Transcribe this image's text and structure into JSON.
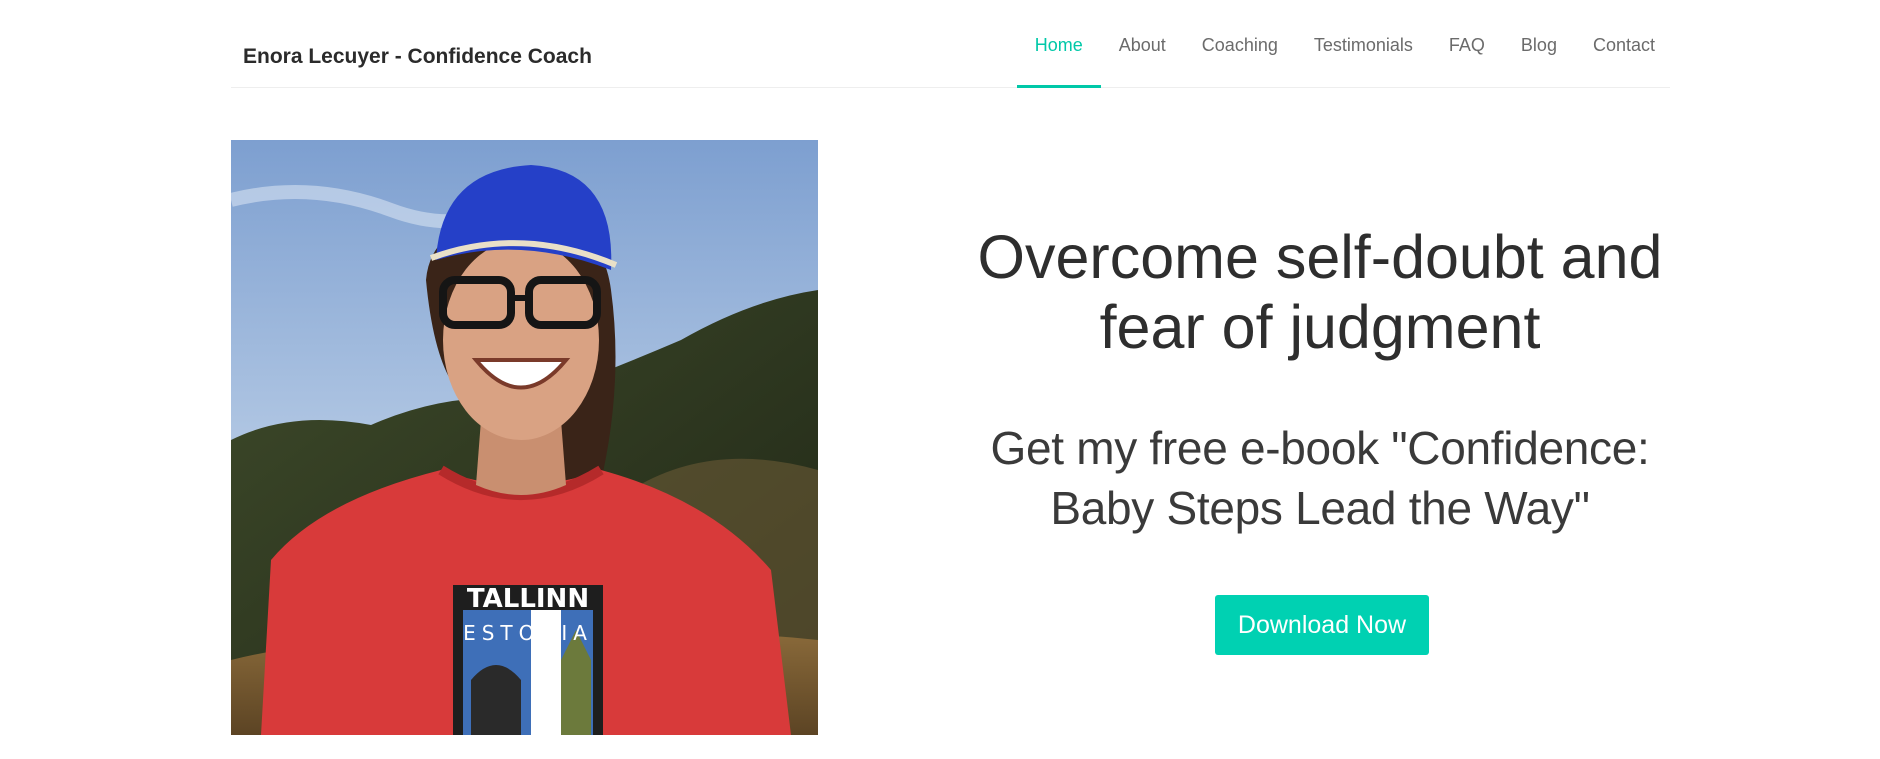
{
  "header": {
    "brand": "Enora Lecuyer - Confidence Coach",
    "nav": [
      {
        "label": "Home",
        "active": true
      },
      {
        "label": "About",
        "active": false
      },
      {
        "label": "Coaching",
        "active": false
      },
      {
        "label": "Testimonials",
        "active": false
      },
      {
        "label": "FAQ",
        "active": false
      },
      {
        "label": "Blog",
        "active": false
      },
      {
        "label": "Contact",
        "active": false
      }
    ]
  },
  "hero": {
    "headline_line1": "Overcome self-doubt and",
    "headline_line2": "fear of judgment",
    "subhead_line1": "Get my free e-book \"Confidence:",
    "subhead_line2": "Baby Steps Lead the Way\"",
    "cta_label": "Download Now",
    "shirt_text_1": "TALLINN",
    "shirt_text_2": "ESTONIA"
  },
  "colors": {
    "accent": "#00d1b2",
    "nav_active": "#00c8a8",
    "text": "#333333"
  }
}
